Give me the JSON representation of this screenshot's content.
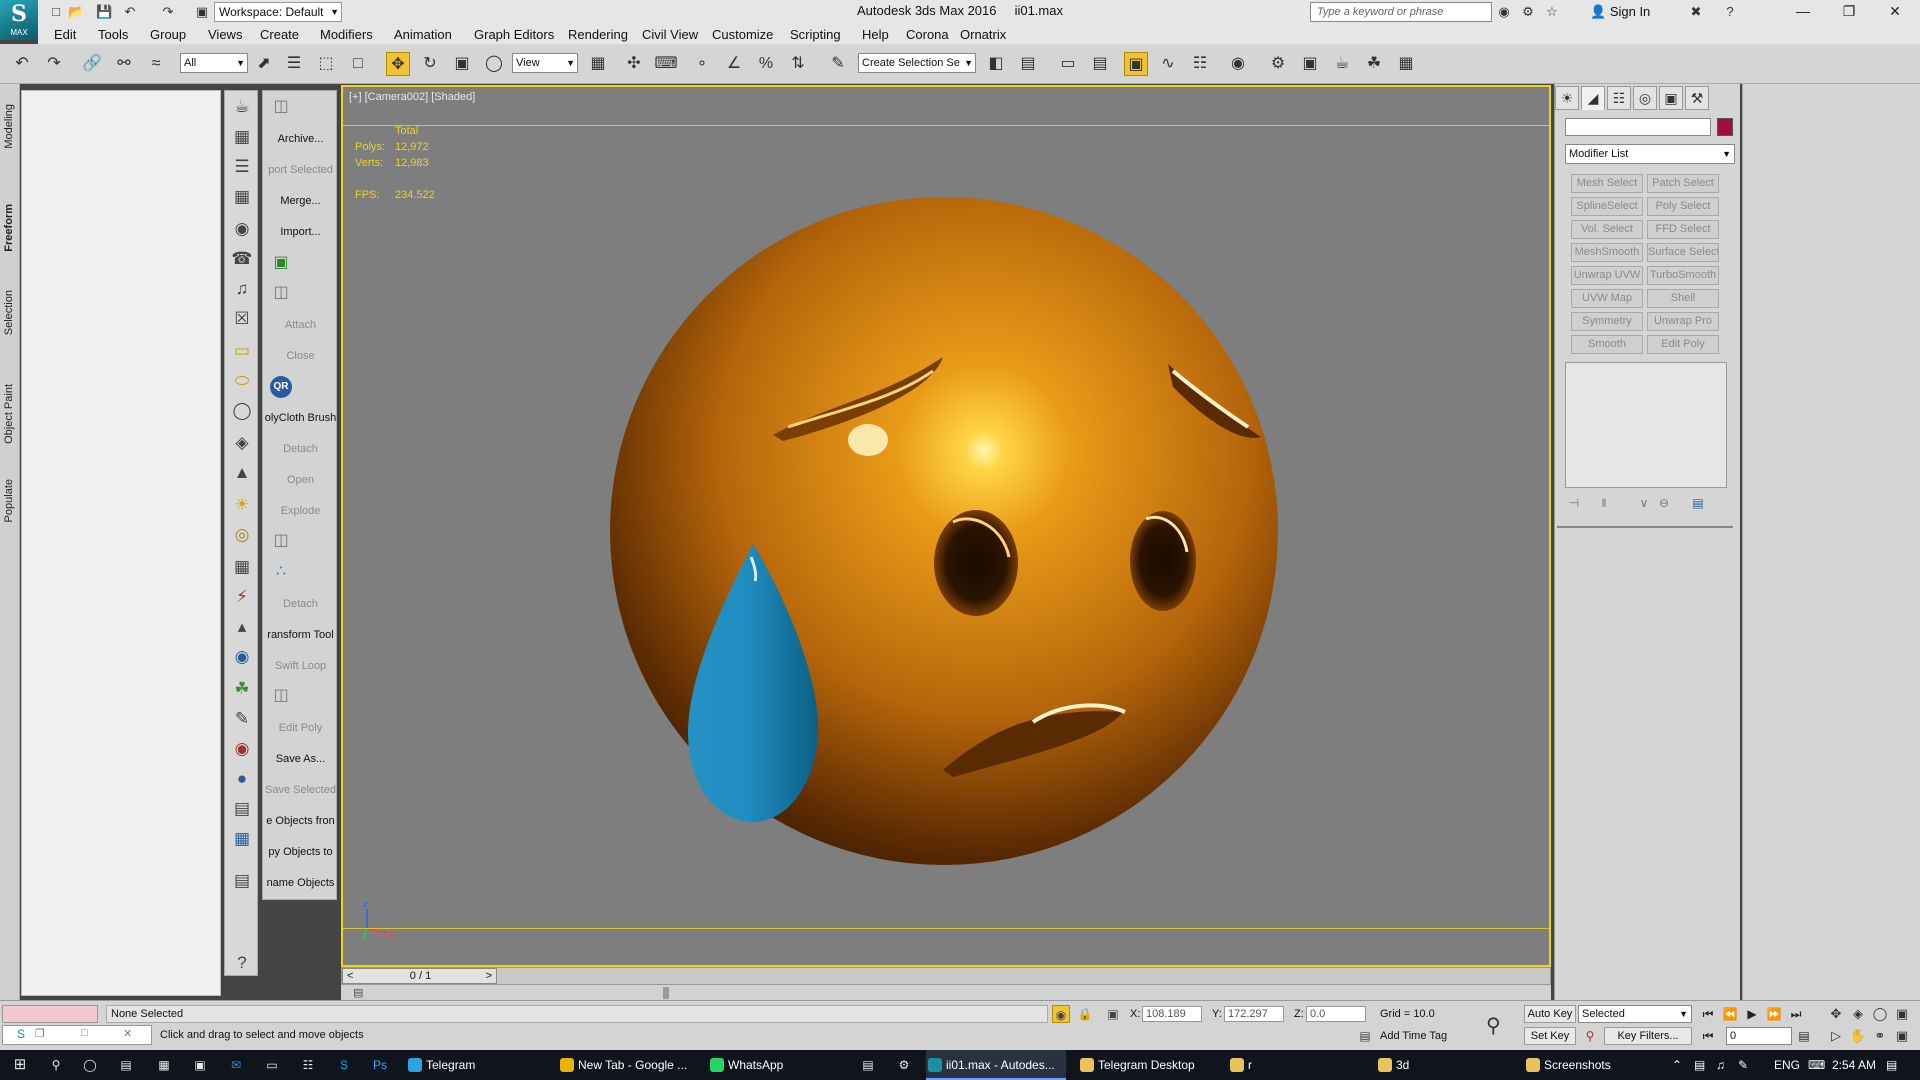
{
  "titlebar": {
    "workspace": "Workspace: Default",
    "app_title": "Autodesk 3ds Max 2016",
    "file_name": "ii01.max",
    "search_placeholder": "Type a keyword or phrase",
    "signin_label": "Sign In",
    "logo_label": "MAX"
  },
  "menu": [
    "Edit",
    "Tools",
    "Group",
    "Views",
    "Create",
    "Modifiers",
    "Animation",
    "Graph Editors",
    "Rendering",
    "Civil View",
    "Customize",
    "Scripting",
    "Help",
    "Corona",
    "Ornatrix"
  ],
  "toolbar": {
    "selection_filter": "All",
    "ref_coord": "View",
    "named_selection": "Create Selection Se"
  },
  "ribbon_tabs": [
    "Modeling",
    "Freeform",
    "Selection",
    "Object Paint",
    "Populate"
  ],
  "command_column": [
    {
      "label": "Archive...",
      "enabled": true
    },
    {
      "label": "port Selected",
      "enabled": false
    },
    {
      "label": "Merge...",
      "enabled": true
    },
    {
      "label": "Import...",
      "enabled": true
    },
    {
      "label": "Attach",
      "enabled": false
    },
    {
      "label": "Close",
      "enabled": false
    },
    {
      "label": "QR",
      "enabled": true
    },
    {
      "label": "olyCloth Brush",
      "enabled": true
    },
    {
      "label": "Detach",
      "enabled": false
    },
    {
      "label": "Open",
      "enabled": false
    },
    {
      "label": "Explode",
      "enabled": false
    },
    {
      "label": "Detach",
      "enabled": false
    },
    {
      "label": "ransform Tool",
      "enabled": true
    },
    {
      "label": "Swift Loop",
      "enabled": false
    },
    {
      "label": "Edit Poly",
      "enabled": false
    },
    {
      "label": "Save As...",
      "enabled": true
    },
    {
      "label": "Save Selected",
      "enabled": false
    },
    {
      "label": "e Objects fron",
      "enabled": true
    },
    {
      "label": "py Objects to",
      "enabled": true
    },
    {
      "label": "name Objects",
      "enabled": true
    }
  ],
  "viewport": {
    "label": "[+] [Camera002] [Shaded]",
    "stats": {
      "total_label": "Total",
      "polys_label": "Polys:",
      "polys": "12,972",
      "verts_label": "Verts:",
      "verts": "12,983",
      "fps_label": "FPS:",
      "fps": "234.522"
    }
  },
  "timeslider": {
    "frame": "0 / 1",
    "prev": "<",
    "next": ">"
  },
  "command_panel": {
    "modifier_list": "Modifier List",
    "object_color": "#a0103c",
    "modifier_buttons": [
      "Mesh Select",
      "Patch Select",
      "SplineSelect",
      "Poly Select",
      "Vol. Select",
      "FFD Select",
      "MeshSmooth",
      "Surface Select",
      "Unwrap UVW",
      "TurboSmooth",
      "UVW Map",
      "Shell",
      "Symmetry",
      "Unwrap Pro",
      "Smooth",
      "Edit Poly"
    ]
  },
  "statusbar": {
    "selection_info": "None Selected",
    "prompt": "Click and drag to select and move objects",
    "x_label": "X:",
    "x": "108.189",
    "y_label": "Y:",
    "y": "172.297",
    "z_label": "Z:",
    "z": "0.0",
    "grid": "Grid = 10.0",
    "add_time_tag": "Add Time Tag",
    "auto_key": "Auto Key",
    "set_key": "Set Key",
    "key_mode": "Selected",
    "key_filters": "Key Filters...",
    "current_frame": "0"
  },
  "taskbar": {
    "apps": [
      {
        "label": "Telegram",
        "color": "#2aa3e0",
        "active": false
      },
      {
        "label": "New Tab - Google ...",
        "color": "#e8b400",
        "active": false
      },
      {
        "label": "WhatsApp",
        "color": "#25d366",
        "active": false
      },
      {
        "label": "ii01.max - Autodes...",
        "color": "#1b8fa3",
        "active": true
      },
      {
        "label": "Telegram Desktop",
        "color": "#e8c35a",
        "active": false
      },
      {
        "label": "r",
        "color": "#e8c35a",
        "active": false
      },
      {
        "label": "3d",
        "color": "#e8c35a",
        "active": false
      },
      {
        "label": "Screenshots",
        "color": "#e8c35a",
        "active": false
      }
    ],
    "language": "ENG",
    "time": "2:54 AM"
  }
}
